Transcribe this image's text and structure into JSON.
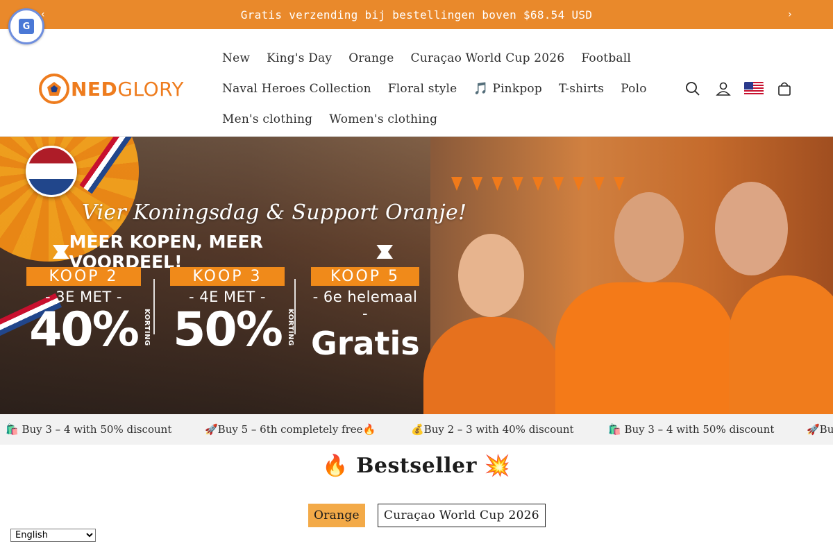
{
  "announcement": {
    "text": "Gratis verzending bij bestellingen boven $68.54 USD",
    "prev_icon": "chevron-left-icon",
    "next_icon": "chevron-right-icon"
  },
  "logo": {
    "ned": "NED",
    "glory": "GLORY"
  },
  "nav": {
    "row1": [
      "New",
      "King's Day",
      "Orange",
      "Curaçao World Cup 2026",
      "Football"
    ],
    "row2": [
      "Naval Heroes Collection",
      "Floral style",
      "🎵 Pinkpop",
      "T-shirts",
      "Polo"
    ],
    "row3": [
      "Men's clothing",
      "Women's clothing"
    ]
  },
  "header_icons": [
    "search-icon",
    "account-icon",
    "us-flag-icon",
    "cart-icon"
  ],
  "hero": {
    "script_line": "Vier Koningsdag & Support Oranje!",
    "headline": "MEER KOPEN, MEER VOORDEEL!",
    "offers": [
      {
        "tag": "KOOP 2",
        "sub": "- 3E MET -",
        "big": "40%",
        "side": "KORTING"
      },
      {
        "tag": "KOOP 3",
        "sub": "- 4E MET -",
        "big": "50%",
        "side": "KORTING"
      },
      {
        "tag": "KOOP 5",
        "sub": "- 6e helemaal -",
        "big": "Gratis",
        "side": ""
      }
    ]
  },
  "marquee": [
    "🛍️ Buy 3 – 4 with 50% discount",
    "🚀Buy 5 – 6th completely free🔥",
    "💰Buy 2 – 3 with 40% discount",
    "🛍️ Buy 3 – 4 with 50% discount",
    "🚀Bu"
  ],
  "bestseller": {
    "title": "🔥 Bestseller 💥",
    "tabs": [
      "Orange",
      "Curaçao World Cup 2026"
    ],
    "active_tab": "Orange"
  },
  "language": {
    "selected": "English"
  },
  "colors": {
    "accent": "#e9892b",
    "tab_active": "#f3aa48",
    "marquee_bg": "#f2f2f2"
  }
}
